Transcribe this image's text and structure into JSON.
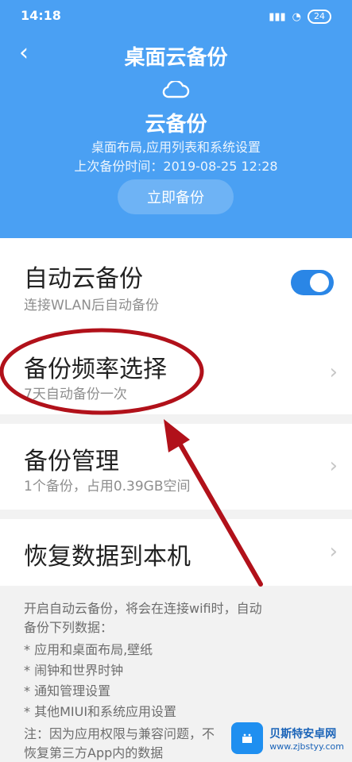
{
  "colors": {
    "header_bg": "#4aa0f3",
    "toggle_on": "#2a86e6",
    "annotation": "#b1111a"
  },
  "statusbar": {
    "time": "14:18",
    "battery": "24"
  },
  "header": {
    "title": "桌面云备份",
    "subtitle": "云备份",
    "desc_line1": "桌面布局,应用列表和系统设置",
    "desc_line2": "上次备份时间：2019-08-25 12:28",
    "backup_button": "立即备份",
    "back_icon": "back-icon",
    "cloud_icon": "cloud-icon"
  },
  "settings": {
    "auto_backup": {
      "title": "自动云备份",
      "subtitle": "连接WLAN后自动备份",
      "enabled": true
    },
    "backup_frequency": {
      "title": "备份频率选择",
      "subtitle": "7天自动备份一次"
    },
    "backup_management": {
      "title": "备份管理",
      "subtitle": "1个备份，占用0.39GB空间"
    },
    "restore": {
      "title": "恢复数据到本机"
    }
  },
  "footer": {
    "line1": "开启自动云备份，将会在连接wifi时，自动",
    "line2": "备份下列数据：",
    "items": [
      "*  应用和桌面布局,壁纸",
      "*  闹钟和世界时钟",
      "*  通知管理设置",
      "*  其他MIUI和系统应用设置"
    ],
    "note1": "注：因为应用权限与兼容问题，不",
    "note2": "恢复第三方App内的数据"
  },
  "watermark": {
    "text": "贝斯特安卓网",
    "url": "www.zjbstyy.com"
  }
}
